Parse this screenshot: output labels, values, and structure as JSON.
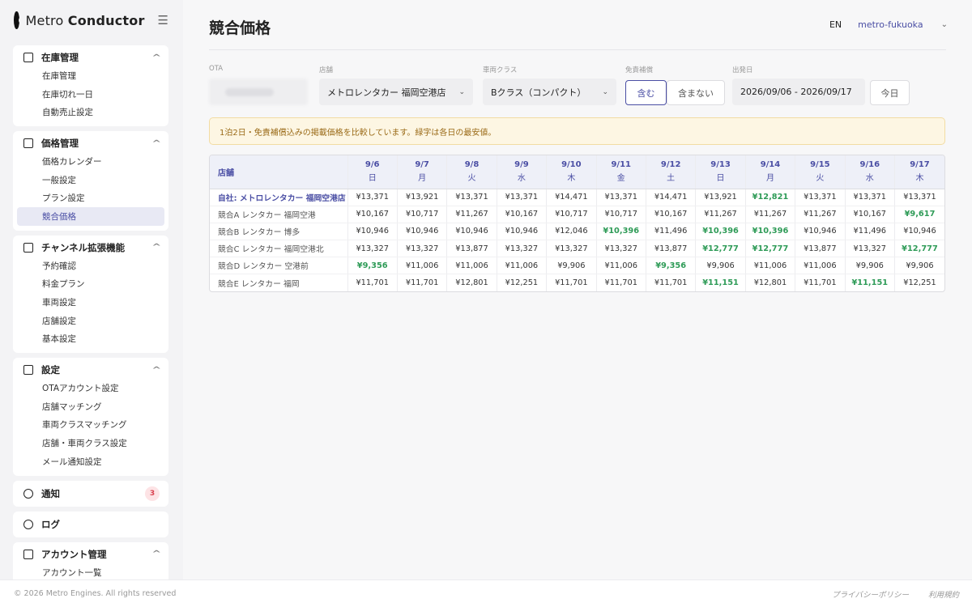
{
  "brand": {
    "name_light": "Metro",
    "name_bold": "Conductor",
    "menu_icon": "hamburger-icon"
  },
  "sidebar": {
    "groups": [
      {
        "title": "在庫管理",
        "items": [
          "在庫管理",
          "在庫切れ一日",
          "自動売止設定"
        ]
      },
      {
        "title": "価格管理",
        "items": [
          "価格カレンダー",
          "一般設定",
          "プラン設定",
          "競合価格"
        ],
        "active_item": "競合価格"
      },
      {
        "title": "チャンネル拡張機能",
        "items": [
          "予約確認",
          "料金プラン",
          "車両設定",
          "店舗設定",
          "基本設定"
        ]
      },
      {
        "title": "設定",
        "items": [
          "OTAアカウント設定",
          "店舗マッチング",
          "車両クラスマッチング",
          "店舗・車両クラス設定",
          "メール通知設定"
        ]
      },
      {
        "title": "通知",
        "badge": "3"
      },
      {
        "title": "ログ"
      },
      {
        "title": "アカウント管理",
        "items": [
          "アカウント一覧"
        ]
      }
    ]
  },
  "header": {
    "title": "競合価格",
    "lang": "EN",
    "tenant": "metro-fukuoka"
  },
  "filters": {
    "ota_label": "OTA",
    "shop_label": "店舗",
    "shop_value": "メトロレンタカー 福岡空港店",
    "class_label": "車両クラス",
    "class_value": "Bクラス（コンパクト）",
    "insurance_label": "免責補償",
    "insurance_include": "含む",
    "insurance_exclude": "含まない",
    "date_label": "出発日",
    "date_range": "2026/09/06 - 2026/09/17",
    "today_button": "今日"
  },
  "notice": "1泊2日・免責補償込みの掲載価格を比較しています。緑字は各日の最安値。",
  "table": {
    "shop_header": "店舗",
    "dates": [
      {
        "date": "9/6",
        "dow": "日"
      },
      {
        "date": "9/7",
        "dow": "月"
      },
      {
        "date": "9/8",
        "dow": "火"
      },
      {
        "date": "9/9",
        "dow": "水"
      },
      {
        "date": "9/10",
        "dow": "木"
      },
      {
        "date": "9/11",
        "dow": "金"
      },
      {
        "date": "9/12",
        "dow": "土"
      },
      {
        "date": "9/13",
        "dow": "日"
      },
      {
        "date": "9/14",
        "dow": "月"
      },
      {
        "date": "9/15",
        "dow": "火"
      },
      {
        "date": "9/16",
        "dow": "水"
      },
      {
        "date": "9/17",
        "dow": "木"
      }
    ],
    "rows": [
      {
        "shop": "自社: メトロレンタカー 福岡空港店",
        "own": true,
        "prices": [
          "¥13,371",
          "¥13,921",
          "¥13,371",
          "¥13,371",
          "¥14,471",
          "¥13,371",
          "¥14,471",
          "¥13,921",
          "¥12,821",
          "¥13,371",
          "¥13,371",
          "¥13,371"
        ],
        "lowest": [
          8
        ]
      },
      {
        "shop": "競合A レンタカー 福岡空港",
        "prices": [
          "¥10,167",
          "¥10,717",
          "¥11,267",
          "¥10,167",
          "¥10,717",
          "¥10,717",
          "¥10,167",
          "¥11,267",
          "¥11,267",
          "¥11,267",
          "¥10,167",
          "¥9,617"
        ],
        "lowest": [
          11
        ]
      },
      {
        "shop": "競合B レンタカー 博多",
        "prices": [
          "¥10,946",
          "¥10,946",
          "¥10,946",
          "¥10,946",
          "¥12,046",
          "¥10,396",
          "¥11,496",
          "¥10,396",
          "¥10,396",
          "¥10,946",
          "¥11,496",
          "¥10,946"
        ],
        "lowest": [
          5,
          7,
          8
        ]
      },
      {
        "shop": "競合C レンタカー 福岡空港北",
        "prices": [
          "¥13,327",
          "¥13,327",
          "¥13,877",
          "¥13,327",
          "¥13,327",
          "¥13,327",
          "¥13,877",
          "¥12,777",
          "¥12,777",
          "¥13,877",
          "¥13,327",
          "¥12,777"
        ],
        "lowest": [
          7,
          8,
          11
        ]
      },
      {
        "shop": "競合D レンタカー 空港前",
        "prices": [
          "¥9,356",
          "¥11,006",
          "¥11,006",
          "¥11,006",
          "¥9,906",
          "¥11,006",
          "¥9,356",
          "¥9,906",
          "¥11,006",
          "¥11,006",
          "¥9,906",
          "¥9,906"
        ],
        "lowest": [
          0,
          6
        ]
      },
      {
        "shop": "競合E レンタカー 福岡",
        "prices": [
          "¥11,701",
          "¥11,701",
          "¥12,801",
          "¥12,251",
          "¥11,701",
          "¥11,701",
          "¥11,701",
          "¥11,151",
          "¥12,801",
          "¥11,701",
          "¥11,151",
          "¥12,251"
        ],
        "lowest": [
          7,
          10
        ]
      }
    ]
  },
  "colors": {
    "accent": "#4a4ea4",
    "lowest_price": "#2e9b57",
    "notice_bg": "#fdf6e3",
    "badge": "#d9414f"
  },
  "footer": {
    "copyright": "© 2026 Metro Engines. All rights reserved",
    "privacy": "プライバシーポリシー",
    "terms": "利用規約"
  }
}
